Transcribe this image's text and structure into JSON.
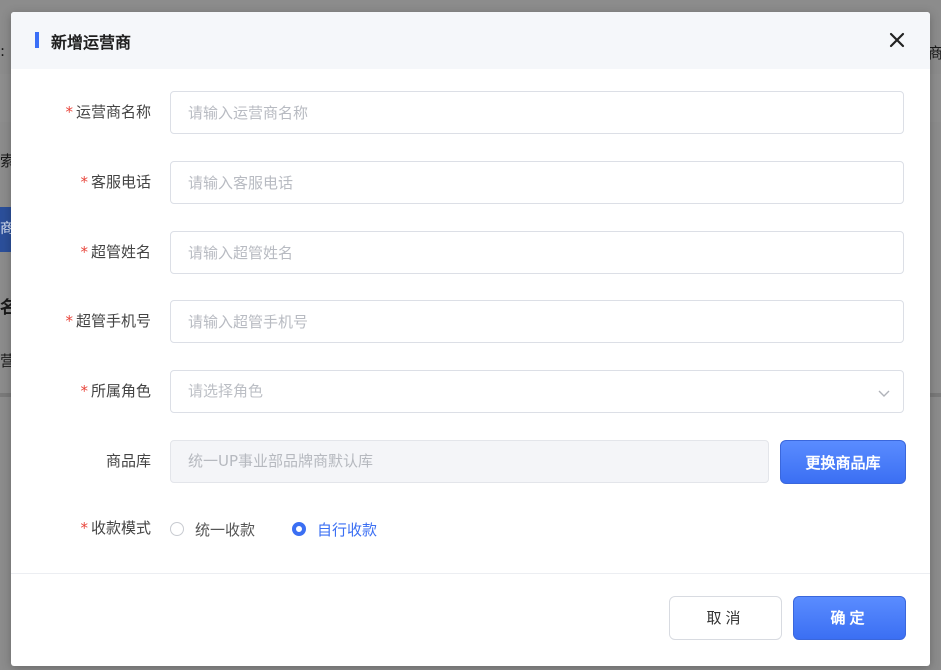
{
  "background": {
    "frag_colon": ":",
    "frag_shang": "商",
    "frag_suo": "索",
    "frag_blue": "商",
    "frag_ming": "名",
    "frag_ying": "营"
  },
  "dialog": {
    "title": "新增运营商",
    "close_icon": "close-icon",
    "required_mark": "*",
    "fields": {
      "operator_name": {
        "label": "运营商名称",
        "placeholder": "请输入运营商名称"
      },
      "service_phone": {
        "label": "客服电话",
        "placeholder": "请输入客服电话"
      },
      "admin_name": {
        "label": "超管姓名",
        "placeholder": "请输入超管姓名"
      },
      "admin_phone": {
        "label": "超管手机号",
        "placeholder": "请输入超管手机号"
      },
      "role": {
        "label": "所属角色",
        "placeholder": "请选择角色",
        "icon": "chevron-down-icon"
      },
      "product_library": {
        "label": "商品库",
        "value": "统一UP事业部品牌商默认库",
        "button": "更换商品库"
      },
      "payment_mode": {
        "label": "收款模式",
        "options": [
          "统一收款",
          "自行收款"
        ],
        "selected": "自行收款"
      }
    },
    "cancel_label": "取消",
    "confirm_label": "确定"
  },
  "colors": {
    "accent": "#3b6ff3",
    "required": "#e8463c",
    "overlay": "#8c8c8c"
  }
}
